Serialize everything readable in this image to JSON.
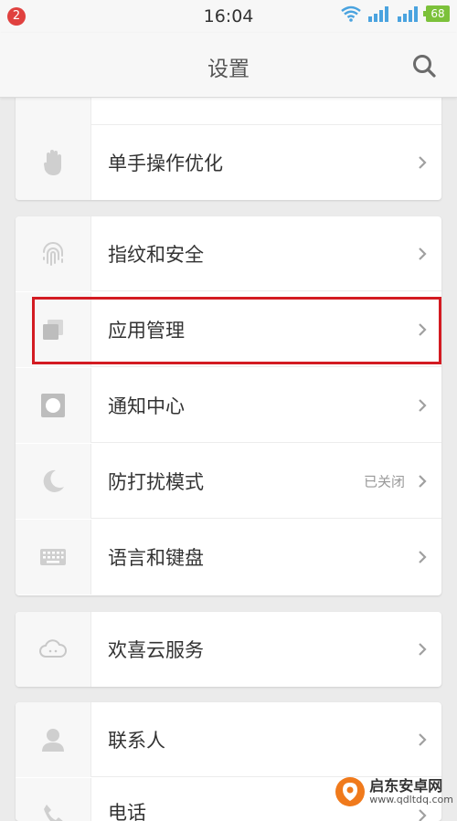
{
  "status_bar": {
    "notification_count": "2",
    "time": "16:04",
    "battery": "68",
    "icons": [
      "wifi-icon",
      "signal-icon",
      "signal-icon"
    ]
  },
  "header": {
    "title": "设置",
    "search_icon": "search-icon"
  },
  "groups": [
    {
      "items": [
        {
          "icon": "partial-icon",
          "label": ""
        },
        {
          "icon": "hand-icon",
          "label": "单手操作优化"
        }
      ]
    },
    {
      "items": [
        {
          "icon": "fingerprint-icon",
          "label": "指纹和安全"
        },
        {
          "icon": "apps-icon",
          "label": "应用管理"
        },
        {
          "icon": "notification-icon",
          "label": "通知中心"
        },
        {
          "icon": "moon-icon",
          "label": "防打扰模式",
          "value": "已关闭"
        },
        {
          "icon": "keyboard-icon",
          "label": "语言和键盘"
        }
      ]
    },
    {
      "items": [
        {
          "icon": "cloud-icon",
          "label": "欢喜云服务"
        }
      ]
    },
    {
      "items": [
        {
          "icon": "contact-icon",
          "label": "联系人"
        },
        {
          "icon": "phone-icon",
          "label": "电话"
        }
      ]
    }
  ],
  "highlight_color": "#d31b22",
  "watermark": {
    "name": "启东安卓网",
    "url": "www.qdltdq.com"
  }
}
